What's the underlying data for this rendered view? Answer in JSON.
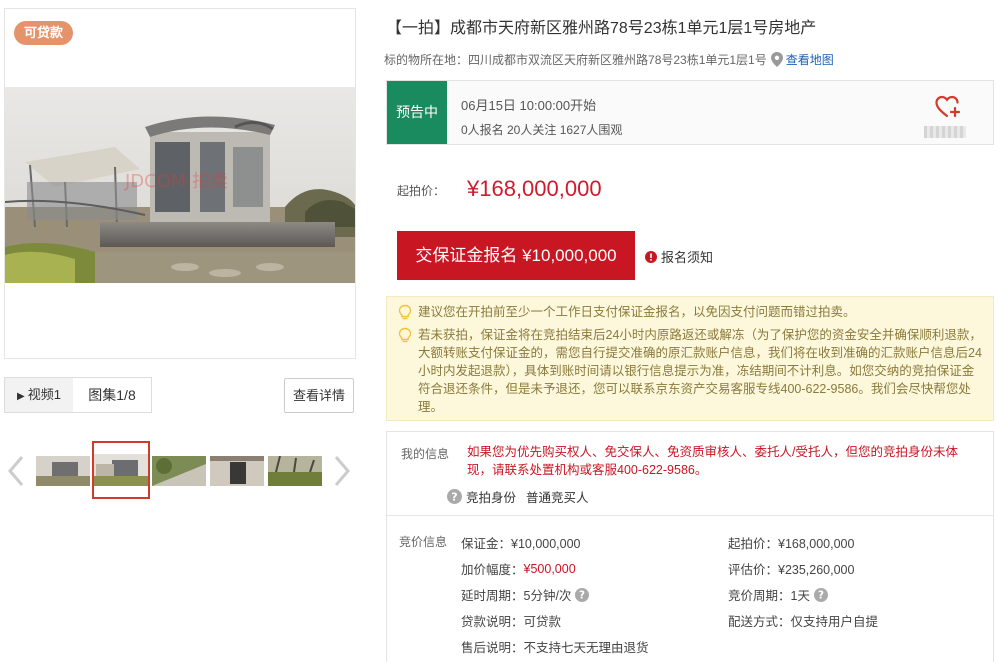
{
  "gallery": {
    "badge": "可贷款",
    "watermark": "JDCOM·拍卖",
    "tabs": {
      "video": "视频1",
      "gallery": "图集1/8"
    },
    "detail_button": "查看详情"
  },
  "lot": {
    "title": "【一拍】成都市天府新区雅州路78号23栋1单元1层1号房地产",
    "location_label": "标的物所在地：",
    "location": "四川成都市双流区天府新区雅州路78号23栋1单元1层1号",
    "map_link": "查看地图"
  },
  "status": {
    "tag": "预告中",
    "start_time": "06月15日 10:00:00开始",
    "counts": "0人报名  20人关注  1627人围观"
  },
  "price": {
    "start_label": "起拍价：",
    "start_value": "¥168,000,000",
    "enroll_button": "交保证金报名 ¥10,000,000",
    "notice_link": "报名须知"
  },
  "tips": [
    "建议您在开拍前至少一个工作日支付保证金报名，以免因支付问题而错过拍卖。",
    "若未获拍，保证金将在竞拍结束后24小时内原路返还或解冻（为了保护您的资金安全并确保顺利退款，大额转账支付保证金的，需您自行提交准确的原汇款账户信息，我们将在收到准确的汇款账户信息后24小时内发起退款），具体到账时间请以银行信息提示为准，冻结期间不计利息。如您交纳的竞拍保证金符合退还条件，但是未予退还，您可以联系京东资产交易客服专线400-622-9586。我们会尽快帮您处理。"
  ],
  "my_info": {
    "label": "我的信息",
    "text": "如果您为优先购买权人、免交保人、免资质审核人、委托人/受托人，但您的竞拍身份未体现，请联系处置机构或客服400-622-9586。",
    "identity_label": "竞拍身份",
    "identity_value": "普通竞买人"
  },
  "bid_info": {
    "label": "竞价信息",
    "deposit": "保证金：¥10,000,000",
    "start": "起拍价：¥168,000,000",
    "increment_label": "加价幅度：",
    "increment_value": "¥500,000",
    "appraisal": "评估价：¥235,260,000",
    "delay": "延时周期：5分钟/次",
    "cycle": "竞价周期：1天",
    "loan": "贷款说明：可贷款",
    "delivery": "配送方式：仅支持用户自提",
    "after_sale": "售后说明：不支持七天无理由退货"
  },
  "colors": {
    "accent_red": "#c81623",
    "status_green": "#1a8b5f",
    "badge_orange": "#e4936a",
    "tip_bg": "#fdf8dc"
  }
}
